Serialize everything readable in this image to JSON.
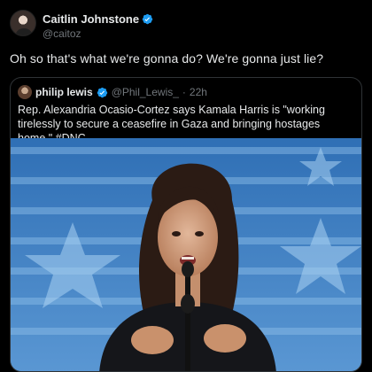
{
  "tweet": {
    "author_name": "Caitlin Johnstone",
    "author_handle": "@caitoz",
    "text": "Oh so that's what we're gonna do? We're gonna just lie?"
  },
  "quoted": {
    "author_name": "philip lewis",
    "author_handle": "@Phil_Lewis_",
    "separator": "·",
    "time": "22h",
    "text": "Rep. Alexandria Ocasio-Cortez says Kamala Harris is \"working tirelessly to secure a ceasefire in Gaza and bringing hostages home.\" #DNC"
  },
  "colors": {
    "verified": "#1d9bf0",
    "stage_blue": "#3f7fc1",
    "stage_stripe": "#7fb2e0"
  },
  "icons": [
    "verified-badge-icon",
    "verified-badge-icon"
  ]
}
